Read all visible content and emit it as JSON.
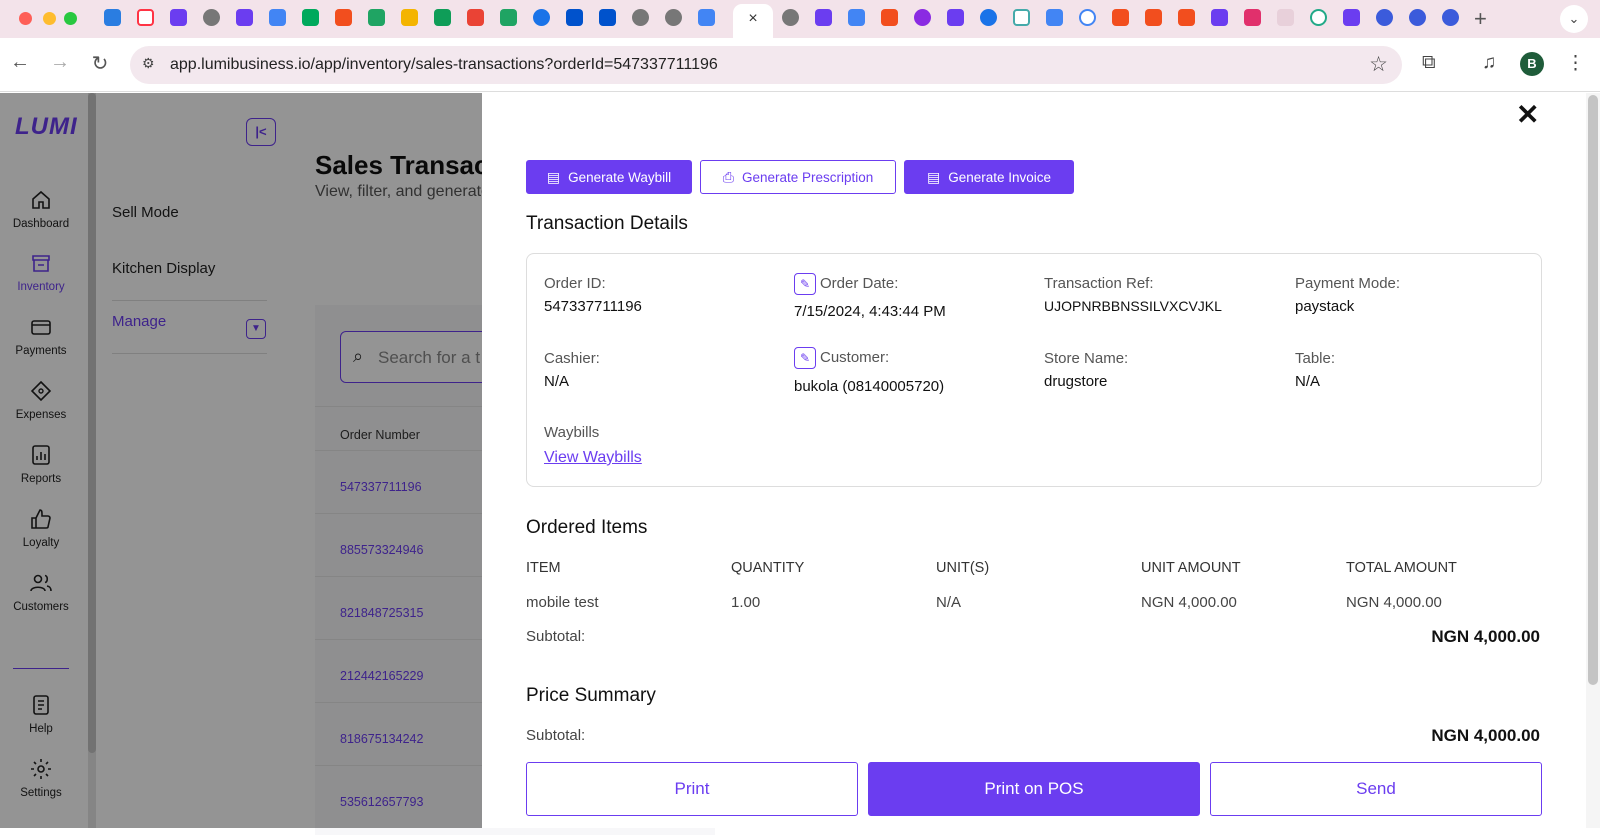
{
  "browser": {
    "active_tab_close": "×",
    "new_tab": "+",
    "tab_menu": "⌄",
    "url": "app.lumibusiness.io/app/inventory/sales-transactions?orderId=547337711196",
    "profile_initial": "B"
  },
  "app": {
    "logo": "LUMI",
    "rail": [
      {
        "label": "Dashboard"
      },
      {
        "label": "Inventory"
      },
      {
        "label": "Payments"
      },
      {
        "label": "Expenses"
      },
      {
        "label": "Reports"
      },
      {
        "label": "Loyalty"
      },
      {
        "label": "Customers"
      },
      {
        "label": "Help"
      },
      {
        "label": "Settings"
      }
    ],
    "subnav": {
      "items": [
        "Sell Mode",
        "Kitchen Display",
        "Manage"
      ]
    },
    "page": {
      "title": "Sales Transactions",
      "subtitle": "View, filter, and generate",
      "search_placeholder": "Search for a t",
      "column_order_number": "Order Number",
      "orders": [
        "547337711196",
        "885573324946",
        "821848725315",
        "212442165229",
        "818675134242",
        "535612657793"
      ]
    }
  },
  "drawer": {
    "buttons": {
      "waybill": "Generate Waybill",
      "prescription": "Generate Prescription",
      "invoice": "Generate Invoice"
    },
    "transaction_details": {
      "title": "Transaction Details",
      "order_id_label": "Order ID:",
      "order_id": "547337711196",
      "order_date_label": "Order Date:",
      "order_date": "7/15/2024, 4:43:44 PM",
      "transaction_ref_label": "Transaction Ref:",
      "transaction_ref": "UJOPNRBBNSSILVXCVJKL",
      "payment_mode_label": "Payment Mode:",
      "payment_mode": "paystack",
      "cashier_label": "Cashier:",
      "cashier": "N/A",
      "customer_label": "Customer:",
      "customer": "bukola (08140005720)",
      "store_name_label": "Store Name:",
      "store_name": "drugstore",
      "table_label": "Table:",
      "table": "N/A",
      "waybills_label": "Waybills",
      "view_waybills": "View Waybills"
    },
    "ordered_items": {
      "title": "Ordered Items",
      "headers": [
        "ITEM",
        "QUANTITY",
        "UNIT(S)",
        "UNIT AMOUNT",
        "TOTAL AMOUNT"
      ],
      "rows": [
        [
          "mobile test",
          "1.00",
          "N/A",
          "NGN 4,000.00",
          "NGN 4,000.00"
        ]
      ],
      "subtotal_label": "Subtotal:",
      "subtotal": "NGN 4,000.00"
    },
    "price_summary": {
      "title": "Price Summary",
      "subtotal_label": "Subtotal:",
      "subtotal": "NGN 4,000.00"
    },
    "actions": {
      "print": "Print",
      "print_pos": "Print on POS",
      "send": "Send"
    }
  }
}
